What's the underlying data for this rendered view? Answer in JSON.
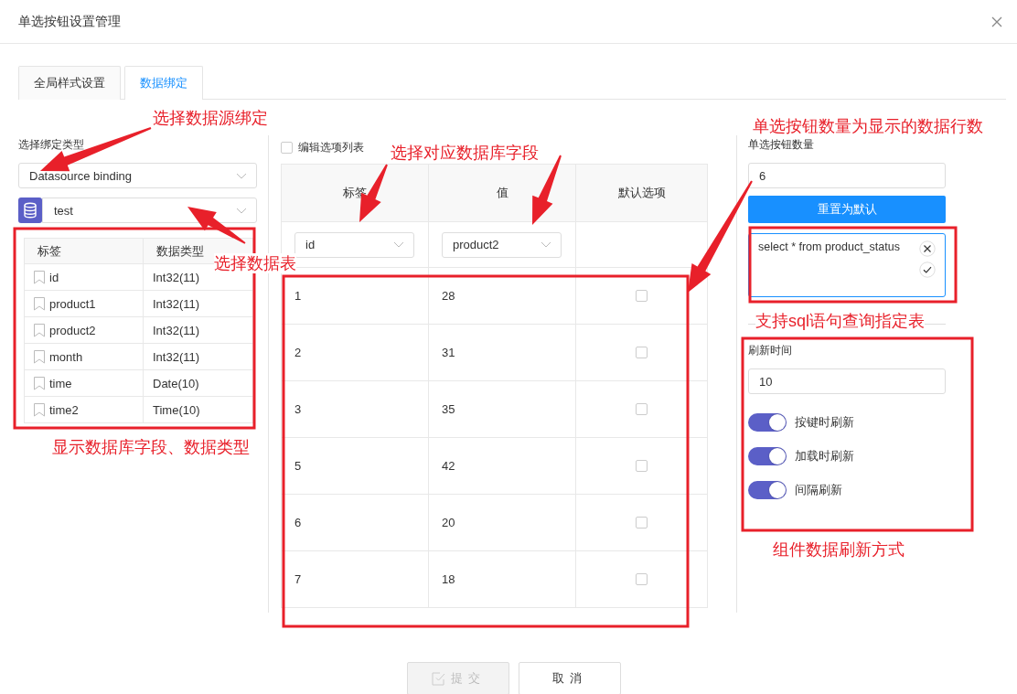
{
  "dialog": {
    "title": "单选按钮设置管理"
  },
  "tabs": [
    {
      "label": "全局样式设置",
      "selected": false
    },
    {
      "label": "数据绑定",
      "selected": true
    }
  ],
  "binding": {
    "type_label": "选择绑定类型",
    "type": "Datasource binding",
    "table": "test",
    "columns": [
      "标签",
      "数据类型"
    ],
    "fields": [
      {
        "name": "id",
        "type": "Int32(11)"
      },
      {
        "name": "product1",
        "type": "Int32(11)"
      },
      {
        "name": "product2",
        "type": "Int32(11)"
      },
      {
        "name": "month",
        "type": "Int32(11)"
      },
      {
        "name": "time",
        "type": "Date(10)"
      },
      {
        "name": "time2",
        "type": "Time(10)"
      }
    ]
  },
  "options": {
    "edit_list": {
      "label": "编辑选项列表",
      "checked": false
    },
    "columns": [
      "标签",
      "值",
      "默认选项"
    ],
    "label_field": "id",
    "value_field": "product2",
    "rows": [
      {
        "label": "1",
        "value": "28",
        "default": false
      },
      {
        "label": "2",
        "value": "31",
        "default": false
      },
      {
        "label": "3",
        "value": "35",
        "default": false
      },
      {
        "label": "5",
        "value": "42",
        "default": false
      },
      {
        "label": "6",
        "value": "20",
        "default": false
      },
      {
        "label": "7",
        "value": "18",
        "default": false
      }
    ]
  },
  "settings": {
    "count_label": "单选按钮数量",
    "count": "6",
    "reset_button": "重置为默认",
    "sql": "select * from product_status",
    "refresh_label": "刷新时间",
    "refresh_time": "10",
    "toggles": [
      {
        "label": "按键时刷新",
        "on": true
      },
      {
        "label": "加载时刷新",
        "on": true
      },
      {
        "label": "间隔刷新",
        "on": true
      }
    ]
  },
  "footer": {
    "buttons": [
      {
        "label": "提交",
        "disabled": true
      },
      {
        "label": "取消",
        "disabled": false
      }
    ]
  },
  "annotations": [
    {
      "text": "选择数据源绑定"
    },
    {
      "text": "选择数据表"
    },
    {
      "text": "选择对应数据库字段"
    },
    {
      "text": "单选按钮数量为显示的数据行数"
    },
    {
      "text": "支持sql语句查询指定表"
    },
    {
      "text": "显示数据库字段、数据类型"
    },
    {
      "text": "组件数据刷新方式"
    }
  ]
}
